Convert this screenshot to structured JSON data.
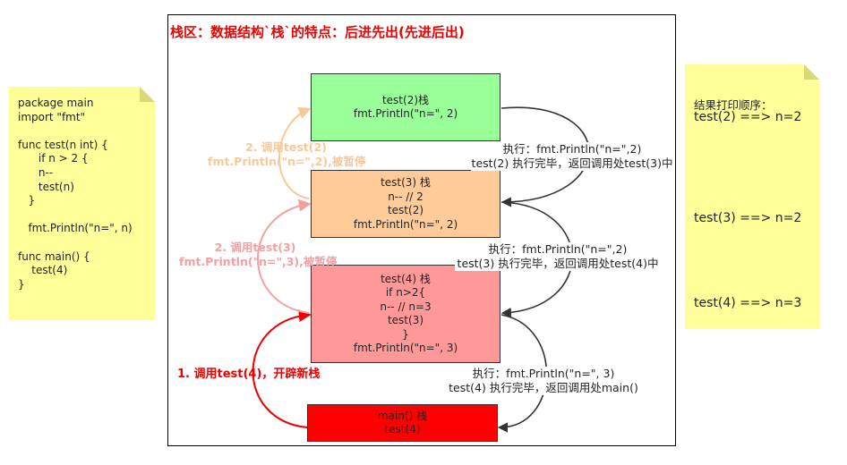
{
  "code_note": {
    "lines": [
      "package main",
      "import \"fmt\"",
      "",
      "func test(n int) {",
      "      if n > 2 {",
      "      n--",
      "      test(n)",
      "   }",
      "",
      "   fmt.Println(\"n=\", n)",
      "",
      "func main() {",
      "    test(4)",
      "}"
    ]
  },
  "title": "栈区：数据结构`栈`的特点：后进先出(先进后出)",
  "boxes": {
    "test2": {
      "lines": [
        "test(2)栈",
        "fmt.Println(\"n=\", 2)"
      ],
      "color": "#99ff99"
    },
    "test3": {
      "lines": [
        "test(3) 栈",
        "n-- // 2",
        "test(2)",
        "fmt.Println(\"n=\", 2)"
      ],
      "color": "#ffcc99"
    },
    "test4": {
      "lines": [
        "test(4) 栈",
        "if n>2{",
        "n-- // n=3",
        "test(3)",
        "}",
        "fmt.Println(\"n=\", 3)"
      ],
      "color": "#ff9999"
    },
    "main": {
      "lines": [
        "main() 栈",
        "test(4)"
      ],
      "color": "#ff0000"
    }
  },
  "call_labels": {
    "call_test4": {
      "lines": [
        "1. 调用test(4)，开辟新栈"
      ],
      "color": "#ee0000"
    },
    "call_test3": {
      "lines": [
        "2. 调用test(3)",
        "fmt.Println(\"n=\",3),被暂停"
      ],
      "color": "#f4a0a0"
    },
    "call_test2": {
      "lines": [
        "2. 调用test(2)",
        "fmt.Println(\"n=\",2),被暂停"
      ],
      "color": "#f8c898"
    }
  },
  "return_labels": {
    "ret_test2": {
      "lines": [
        "执行：fmt.Println(\"n=\",2)",
        "test(2) 执行完毕，返回调用处test(3)中"
      ]
    },
    "ret_test3": {
      "lines": [
        "执行：fmt.Println(\"n=\",2)",
        "test(3) 执行完毕，返回调用处test(4)中"
      ]
    },
    "ret_test4": {
      "lines": [
        "执行：fmt.Println(\"n=\", 3)",
        "test(4) 执行完毕，返回调用处main()"
      ]
    }
  },
  "result_note": {
    "heading": "结果打印顺序：",
    "results": [
      "test(2) ==> n=2",
      "test(3) ==> n=2",
      "test(4) ==> n=3"
    ]
  },
  "colors": {
    "call_red": "#ee0000",
    "call_pink": "#f4a0a0",
    "call_peach": "#f8c898",
    "return_dark": "#333333"
  }
}
